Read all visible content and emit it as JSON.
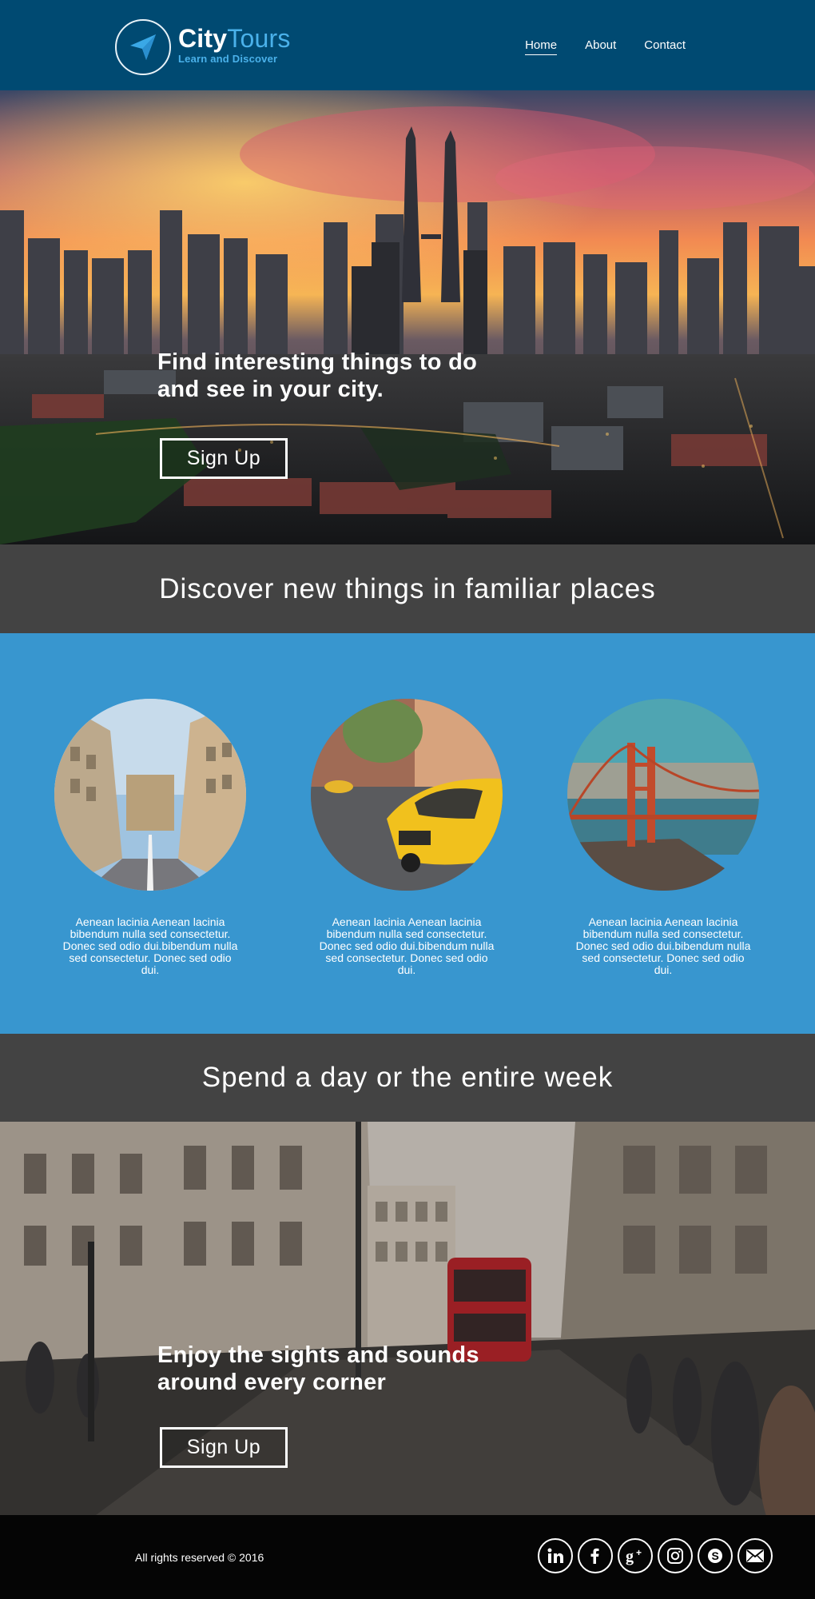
{
  "brand": {
    "name_first": "City",
    "name_second": "Tours",
    "tagline": "Learn and Discover",
    "icon": "paper-plane-icon"
  },
  "nav": {
    "items": [
      {
        "label": "Home",
        "active": true
      },
      {
        "label": "About",
        "active": false
      },
      {
        "label": "Contact",
        "active": false
      }
    ]
  },
  "hero": {
    "heading": "Find interesting things to do and see in your city.",
    "button_label": "Sign Up"
  },
  "banner1": {
    "title": "Discover new things in familiar places"
  },
  "features": [
    {
      "image": "city-street-photo",
      "text": "Aenean lacinia Aenean lacinia bibendum nulla sed consectetur. Donec sed odio dui.bibendum nulla sed consectetur. Donec sed odio dui."
    },
    {
      "image": "yellow-taxi-photo",
      "text": "Aenean lacinia Aenean lacinia bibendum nulla sed consectetur. Donec sed odio dui.bibendum nulla sed consectetur. Donec sed odio dui."
    },
    {
      "image": "golden-gate-bridge-photo",
      "text": "Aenean lacinia Aenean lacinia bibendum nulla sed consectetur. Donec sed odio dui.bibendum nulla sed consectetur. Donec sed odio dui."
    }
  ],
  "banner2": {
    "title": "Spend a day or the entire week"
  },
  "street": {
    "heading": "Enjoy the sights and sounds around every corner",
    "button_label": "Sign Up"
  },
  "footer": {
    "copyright": "All rights reserved © 2016",
    "socials": [
      "linkedin-icon",
      "facebook-icon",
      "google-plus-icon",
      "instagram-icon",
      "skype-icon",
      "email-icon"
    ]
  },
  "colors": {
    "header_bg": "#004a72",
    "accent": "#4ab1ea",
    "features_bg": "#3896cf",
    "banner_bg": "#434343",
    "footer_bg": "#050505"
  }
}
